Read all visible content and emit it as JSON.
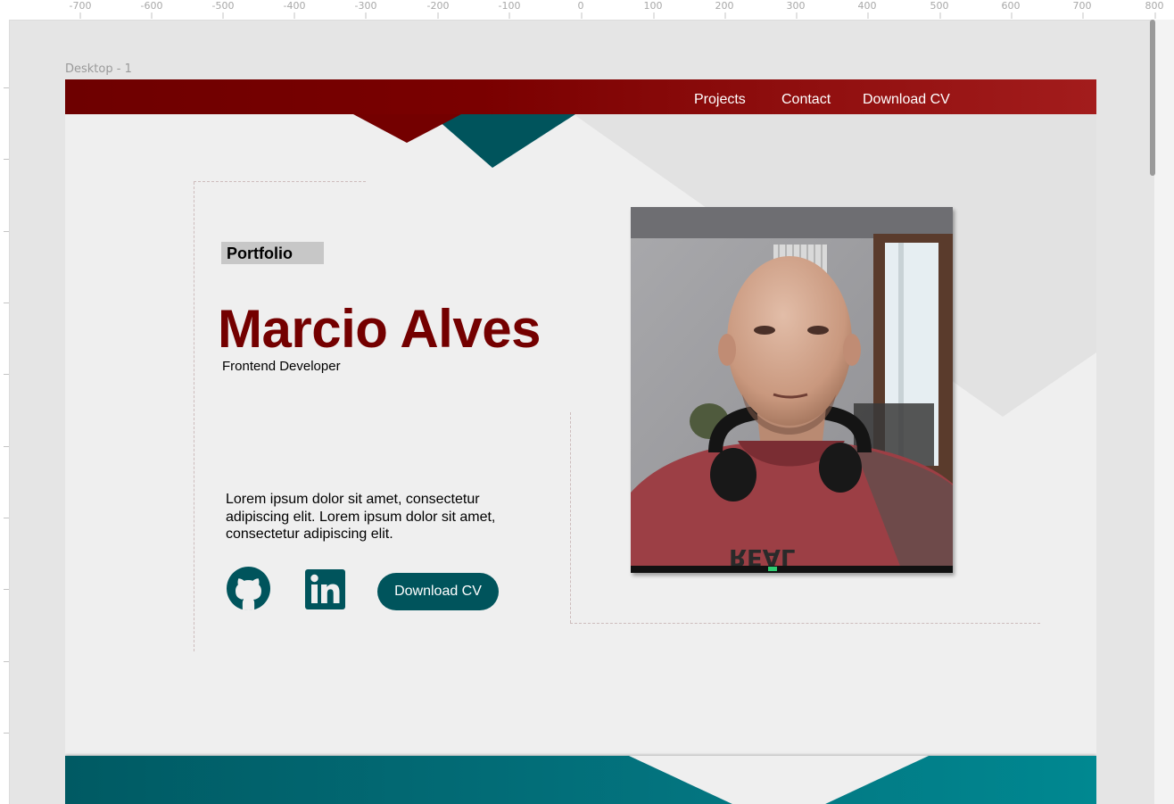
{
  "canvas": {
    "frame_label": "Desktop - 1",
    "ruler_ticks": [
      "-700",
      "-600",
      "-500",
      "-400",
      "-300",
      "-200",
      "-100",
      "0",
      "100",
      "200",
      "300",
      "400",
      "500",
      "600",
      "700",
      "800"
    ]
  },
  "nav": {
    "links": [
      "Projects",
      "Contact",
      "Download CV"
    ]
  },
  "hero": {
    "tag": "Portfolio",
    "name": "Marcio Alves",
    "role": "Frontend Developer",
    "description": "Lorem ipsum dolor sit amet, consectetur adipiscing elit.  Lorem ipsum dolor sit amet, consectetur adipiscing elit.",
    "cta_label": "Download CV",
    "social_icons": [
      "github-icon",
      "linkedin-icon"
    ],
    "photo": "profile-photo"
  },
  "colors": {
    "primary_red": "#740000",
    "nav_red_end": "#a31c1c",
    "teal": "#00545c",
    "frame_bg": "#efefef"
  }
}
